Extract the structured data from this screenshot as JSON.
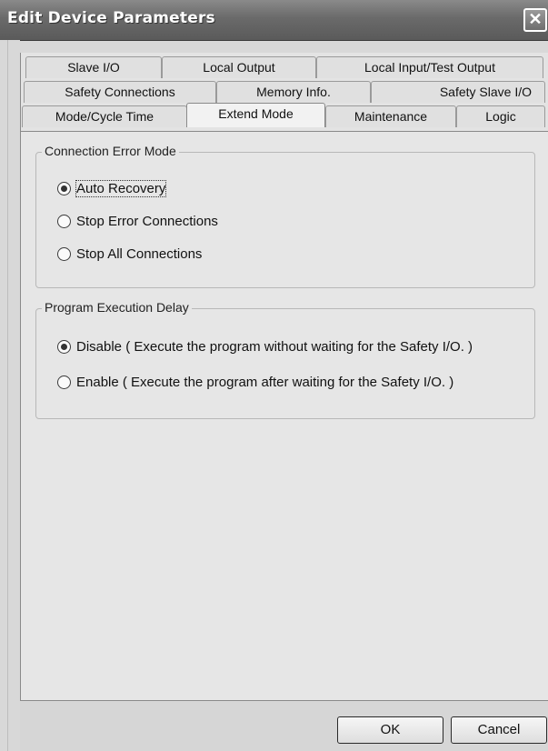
{
  "window": {
    "title": "Edit Device Parameters",
    "close_glyph": "✕"
  },
  "tabs": {
    "row1": [
      {
        "label": "Slave I/O"
      },
      {
        "label": "Local Output"
      },
      {
        "label": "Local Input/Test Output"
      }
    ],
    "row2": [
      {
        "label": "Safety Connections"
      },
      {
        "label": "Memory Info."
      },
      {
        "label": "Safety Slave I/O"
      }
    ],
    "row3": [
      {
        "label": "Mode/Cycle Time"
      },
      {
        "label": "Extend Mode",
        "active": true
      },
      {
        "label": "Maintenance"
      },
      {
        "label": "Logic"
      }
    ]
  },
  "connection_error_mode": {
    "legend": "Connection Error Mode",
    "options": [
      {
        "label": "Auto Recovery",
        "checked": true
      },
      {
        "label": "Stop Error Connections",
        "checked": false
      },
      {
        "label": "Stop All Connections",
        "checked": false
      }
    ]
  },
  "program_execution_delay": {
    "legend": "Program Execution Delay",
    "options": [
      {
        "label": "Disable ( Execute the program without waiting for the Safety I/O. )",
        "checked": true
      },
      {
        "label": "Enable ( Execute the program after waiting for the Safety I/O. )",
        "checked": false
      }
    ]
  },
  "buttons": {
    "ok": "OK",
    "cancel": "Cancel"
  },
  "icons": {
    "close": "close-icon",
    "radio": "radio-button-icon"
  },
  "colors": {
    "titlebar": "#6a6a6a",
    "dialog_bg": "#e6e6e6"
  }
}
